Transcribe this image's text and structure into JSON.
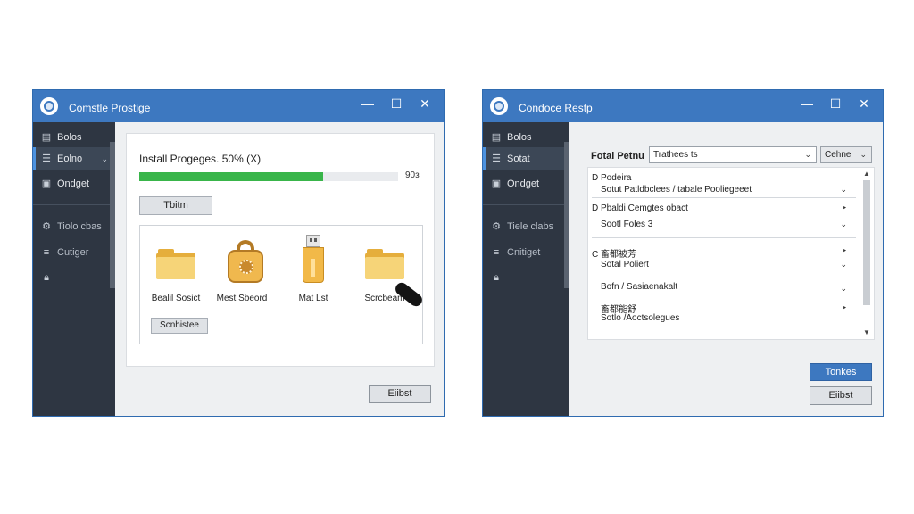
{
  "left_window": {
    "title": "Comstle Prostige",
    "controls": {
      "minimize": "—",
      "maximize": "☐",
      "close": "✕"
    },
    "sidebar": {
      "items": [
        {
          "icon": "doc-icon",
          "label": "Bolos"
        },
        {
          "icon": "list-icon",
          "label": "Eolno",
          "active": true
        },
        {
          "icon": "config-icon",
          "label": "Ondget"
        },
        {
          "icon": "gear-icon",
          "label": "Tiolo cbas"
        },
        {
          "icon": "menu-icon",
          "label": "Cutiger"
        },
        {
          "icon": "lock-icon",
          "label": ""
        }
      ]
    },
    "main": {
      "install_text": "Install Progeges. 50% (X)",
      "progress": {
        "fraction": 0.71,
        "value_label": "90з"
      },
      "tab_button": "Tbitm",
      "tiles": [
        {
          "icon": "folder-icon",
          "label": "Bealil Sosict"
        },
        {
          "icon": "package-icon",
          "label": "Mest Sbeord"
        },
        {
          "icon": "usb-drive-icon",
          "label": "Mat Lst"
        },
        {
          "icon": "folder-icon",
          "label": "Scrcbeam"
        }
      ],
      "small_button": "Scnhistee",
      "bottom_button": "Eiibst"
    }
  },
  "right_window": {
    "title": "Condoce Restp",
    "controls": {
      "minimize": "—",
      "maximize": "☐",
      "close": "✕"
    },
    "sidebar": {
      "items": [
        {
          "icon": "doc-icon",
          "label": "Bolos"
        },
        {
          "icon": "list-icon",
          "label": "Sotat",
          "active": true
        },
        {
          "icon": "config-icon",
          "label": "Ondget"
        },
        {
          "icon": "gear-icon",
          "label": "Tiele clabs"
        },
        {
          "icon": "menu-icon",
          "label": "Cnitiget"
        },
        {
          "icon": "lock-icon",
          "label": ""
        }
      ]
    },
    "main": {
      "header_label": "Fotal Petnu",
      "select_main": "Trathees ts",
      "select_side": "Cehne",
      "rows": [
        {
          "prefix": "D",
          "text": "Podeira",
          "mark": ""
        },
        {
          "prefix": "",
          "text": "Sotut Patldbclees / tabale Pooliegeeet",
          "mark": "⌄"
        },
        {
          "prefix": "D",
          "text": "Pbaldi Cemgtes obact",
          "mark": "‣"
        },
        {
          "prefix": "",
          "text": "Sootl Foles 3",
          "mark": "⌄"
        },
        {
          "prefix": "C",
          "text": "畜都被芳",
          "mark": "‣"
        },
        {
          "prefix": "",
          "text": "Sotal Poliert",
          "mark": "⌄"
        },
        {
          "prefix": "",
          "text": "Bofn / Sasiaenakalt",
          "mark": "⌄"
        },
        {
          "prefix": "",
          "text": "畜都能舒",
          "mark": "‣"
        },
        {
          "prefix": "",
          "text": "Sotlo /Aoctsolegues",
          "mark": "⌄"
        }
      ],
      "scroll_up": "▲",
      "scroll_down": "▼",
      "primary_button": "Tonkes",
      "bottom_button": "Eiibst"
    }
  },
  "colors": {
    "titlebar": "#3d78c0",
    "sidebar": "#2e3642",
    "progress": "#39b54a",
    "primary_button": "#3d78c0"
  }
}
